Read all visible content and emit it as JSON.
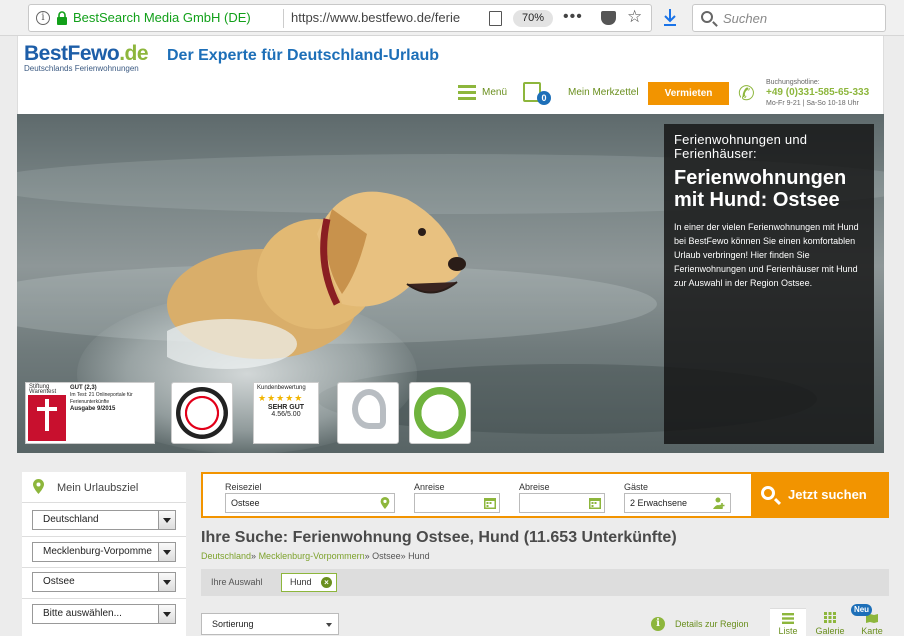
{
  "browser": {
    "site_identity": "BestSearch Media GmbH (DE)",
    "url": "https://www.bestfewo.de/ferie",
    "zoom": "70%",
    "menu_dots": "•••",
    "bookmark_star": "☆",
    "search_placeholder": "Suchen"
  },
  "header": {
    "logo_main": "BestFewo",
    "logo_tld": ".de",
    "logo_sub": "Deutschlands Ferienwohnungen",
    "tagline": "Der Experte für Deutschland-Urlaub",
    "menu_label": "Menü",
    "merkzettel_count": "0",
    "merkzettel_label": "Mein Merkzettel",
    "vermieten_label": "Vermieten",
    "hotline_caption": "Buchungshotline:",
    "hotline_number": "+49 (0)331-585-65-333",
    "hotline_hours": "Mo-Fr 9-21 | Sa-So 10-18 Uhr"
  },
  "hero": {
    "kicker": "Ferienwohnungen und Ferienhäuser:",
    "headline": "Ferienwohnungen mit Hund: Ostsee",
    "text": "In einer der vielen Ferienwohnungen mit Hund bei BestFewo können Sie einen komfortablen Urlaub verbringen! Hier finden Sie Ferienwohnungen und Ferienhäuser mit Hund zur Auswahl in der Region Ostsee.",
    "seals": {
      "stiftung_title": "Stiftung Warentest",
      "stiftung_grade": "GUT (2,3)",
      "stiftung_text": "Im Test: 21 Onlineportale für Ferienunterkünfte",
      "stiftung_issue": "Ausgabe 9/2015",
      "review_title": "Kundenbewertung",
      "review_stars": "★★★★★",
      "review_grade": "SEHR GUT",
      "review_score": "4.56/5.00"
    }
  },
  "sidebar": {
    "title": "Mein Urlaubsziel",
    "country": "Deutschland",
    "state": "Mecklenburg-Vorpomme",
    "region": "Ostsee",
    "place": "Bitte auswählen..."
  },
  "search": {
    "reiseziel_label": "Reiseziel",
    "reiseziel_value": "Ostsee",
    "anreise_label": "Anreise",
    "anreise_value": "",
    "abreise_label": "Abreise",
    "abreise_value": "",
    "gaeste_label": "Gäste",
    "gaeste_value": "2 Erwachsene",
    "submit_label": "Jetzt suchen"
  },
  "results": {
    "title": "Ihre Suche: Ferienwohnung Ostsee, Hund (11.653 Unterkünfte)",
    "breadcrumb": [
      "Deutschland",
      "Mecklenburg-Vorpommern",
      "Ostsee",
      "Hund"
    ],
    "selection_label": "Ihre Auswahl",
    "selection_chip": "Hund",
    "sort_label": "Sortierung",
    "details_label": "Details zur Region",
    "views": [
      "Liste",
      "Galerie",
      "Karte"
    ],
    "new_badge": "Neu"
  },
  "colors": {
    "brand_blue": "#1d6fb8",
    "brand_green": "#8db63c",
    "accent_orange": "#f29400"
  }
}
